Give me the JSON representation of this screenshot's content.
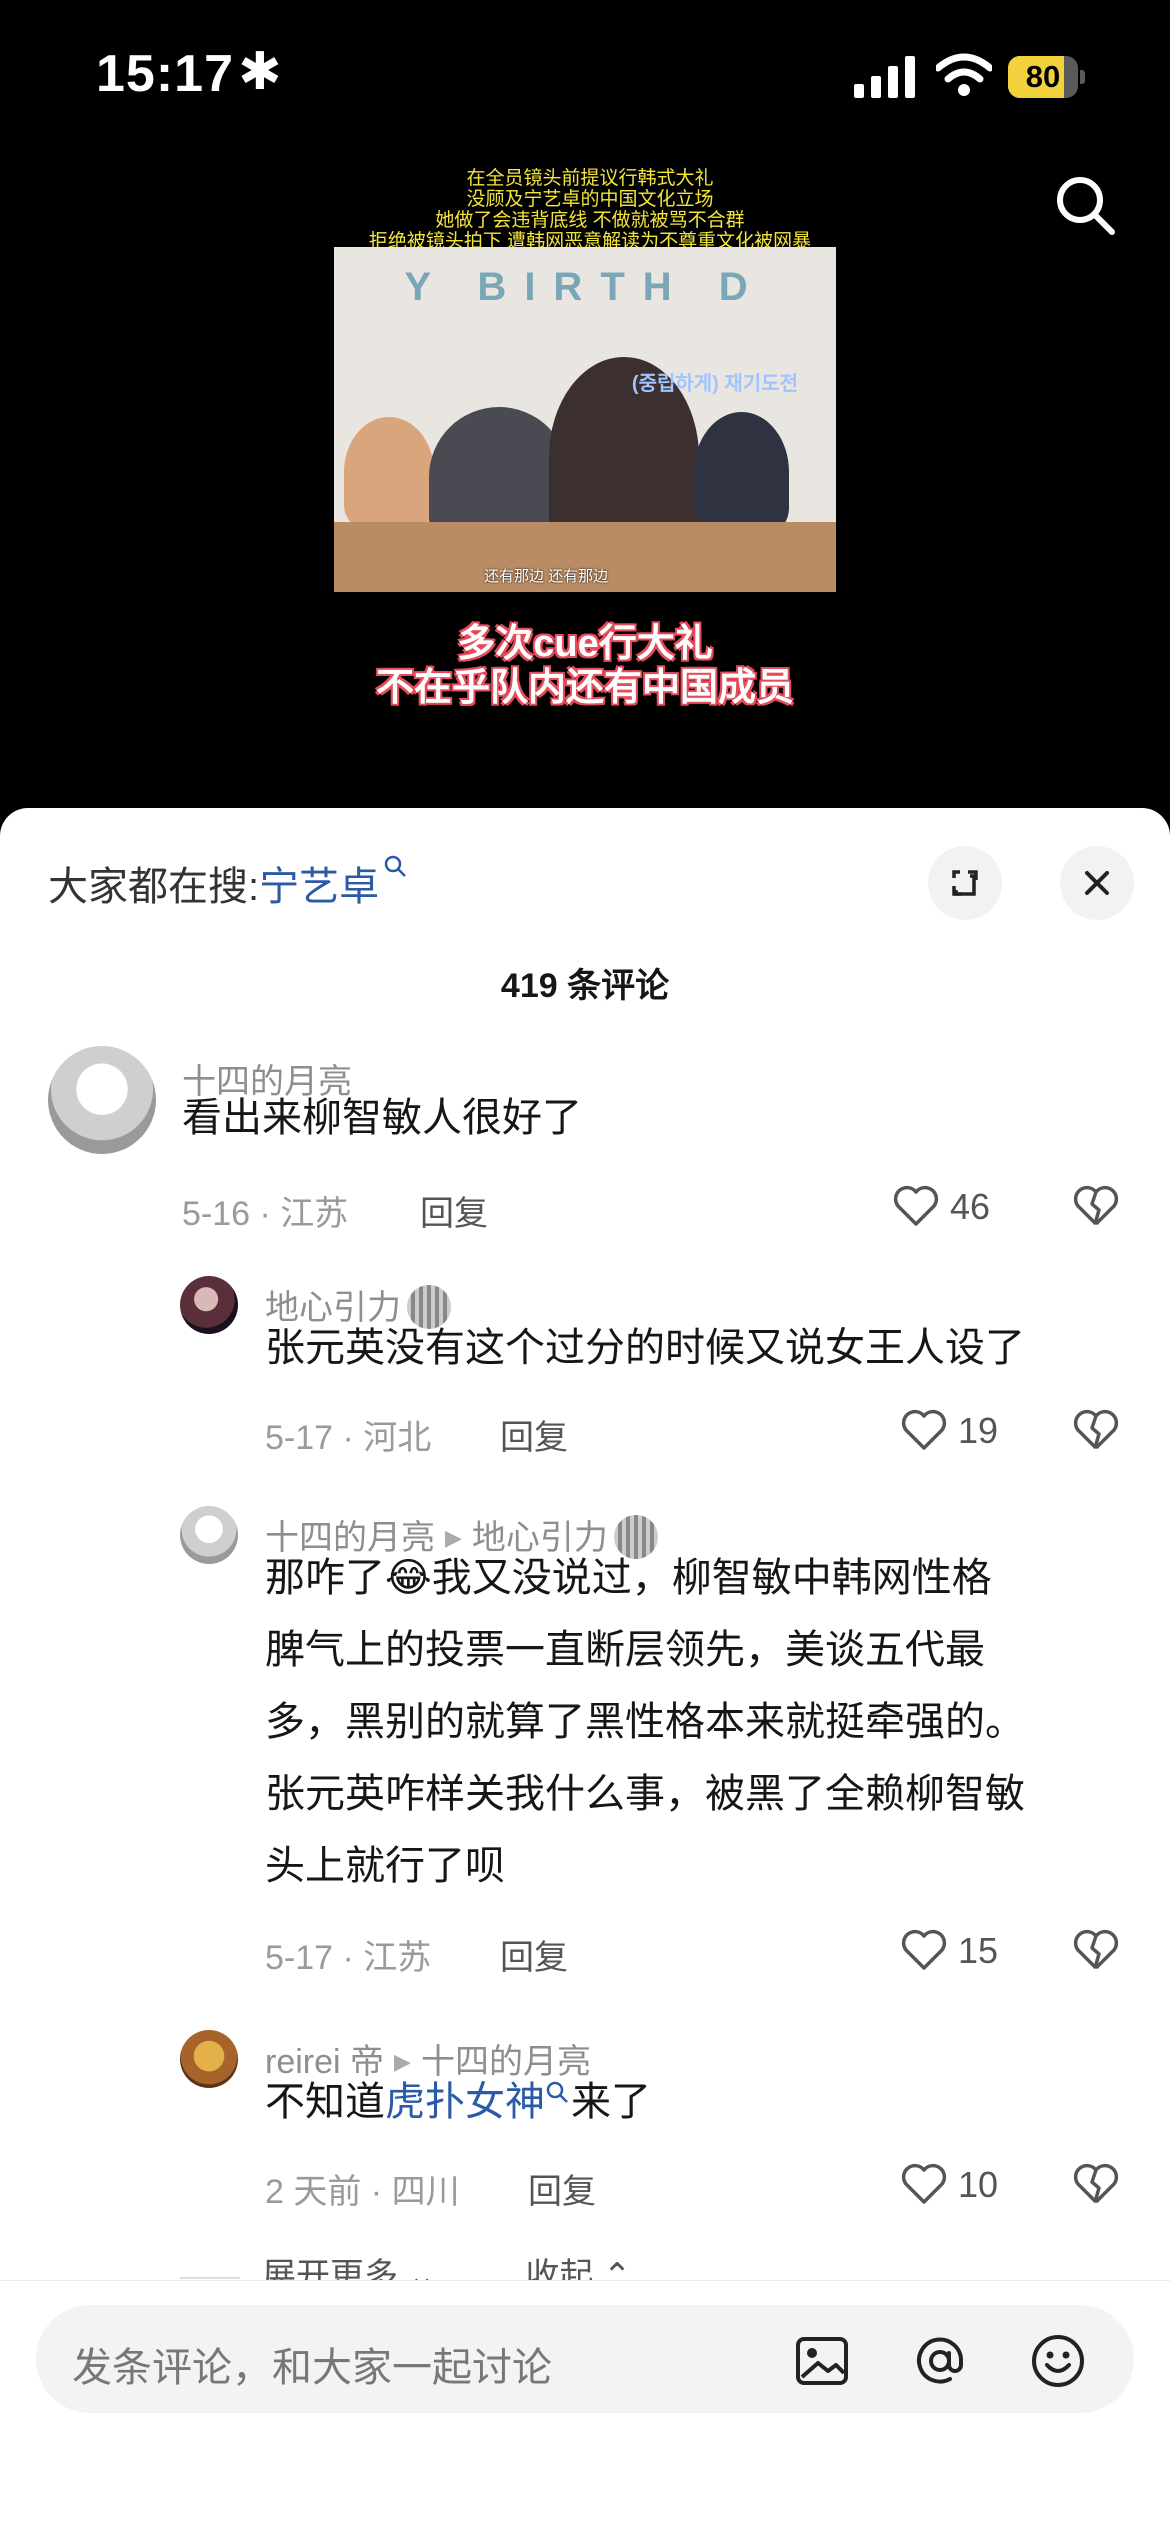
{
  "status_bar": {
    "time": "15:17",
    "star": "✱",
    "battery": "80",
    "battery_level": 0.8
  },
  "video": {
    "caption_lines": [
      "在全员镜头前提议行韩式大礼",
      "没顾及宁艺卓的中国文化立场",
      "她做了会违背底线 不做就被骂不合群",
      "拒绝被镜头拍下 遭韩网恶意解读为不尊重文化被网暴"
    ],
    "frame_banner": "Y BIRTH D",
    "frame_subtitle": "还有那边 还有那边",
    "frame_logo": "(중립하게) 재기도전",
    "title_lines": [
      "多次cue行大礼",
      "不在乎队内还有中国成员"
    ]
  },
  "sheet": {
    "suggest_prefix": "大家都在搜:",
    "suggest_keyword": "宁艺卓",
    "comment_count": "419 条评论"
  },
  "comments": [
    {
      "user": "十四的月亮",
      "text": "看出来柳智敏人很好了",
      "date": "5-16 · 江苏",
      "reply": "回复",
      "likes": "46"
    },
    {
      "user": "地心引力",
      "text": "张元英没有这个过分的时候又说女王人设了",
      "date": "5-17 · 河北",
      "reply": "回复",
      "likes": "19"
    },
    {
      "user": "十四的月亮",
      "to": "地心引力",
      "lines": [
        "那咋了😂我又没说过，柳智敏中韩网性格",
        "脾气上的投票一直断层领先，美谈五代最",
        "多，黑别的就算了黑性格本来就挺牵强的。",
        "张元英咋样关我什么事，被黑了全赖柳智敏",
        "头上就行了呗"
      ],
      "date": "5-17 · 江苏",
      "reply": "回复",
      "likes": "15"
    },
    {
      "user": "reirei 帝",
      "to": "十四的月亮",
      "text_pre": "不知道",
      "text_link": "虎扑女神",
      "text_post": "来了",
      "date": "2 天前 · 四川",
      "reply": "回复",
      "likes": "10"
    }
  ],
  "more": {
    "expand": "展开更多",
    "collapse": "收起"
  },
  "bottom": {
    "placeholder": "发条评论，和大家一起讨论"
  }
}
